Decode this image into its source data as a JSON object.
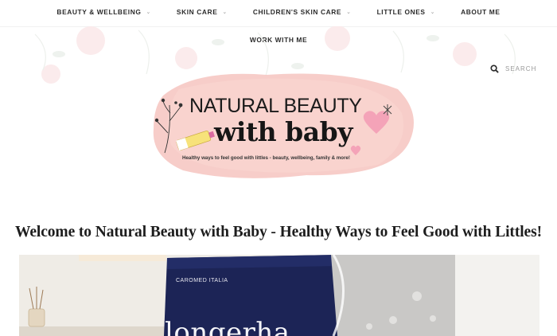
{
  "nav": {
    "row1": [
      {
        "label": "BEAUTY & WELLBEING",
        "has_dropdown": true
      },
      {
        "label": "SKIN CARE",
        "has_dropdown": true
      },
      {
        "label": "CHILDREN'S SKIN CARE",
        "has_dropdown": true
      },
      {
        "label": "LITTLE ONES",
        "has_dropdown": true
      },
      {
        "label": "ABOUT ME",
        "has_dropdown": false
      }
    ],
    "row2": [
      {
        "label": "WORK WITH ME",
        "has_dropdown": false
      }
    ],
    "dropdown_icon": "chevron-down-icon"
  },
  "search": {
    "label": "SEARCH",
    "icon": "search-icon"
  },
  "logo": {
    "line1": "NATURAL BEAUTY",
    "line2": "with baby",
    "tagline": "Healthy ways to feel good with littles - beauty, wellbeing, family & more!"
  },
  "headline": "Welcome to Natural Beauty with Baby - Healthy Ways to Feel Good with Littles!",
  "feature": {
    "brand": "CAROMED ITALIA",
    "product": "longerha"
  },
  "colors": {
    "logo_blush": "#f4b9b5",
    "heart_pink": "#f39fb6",
    "product_navy": "#1c2456",
    "text_dark": "#1d1d1d"
  }
}
